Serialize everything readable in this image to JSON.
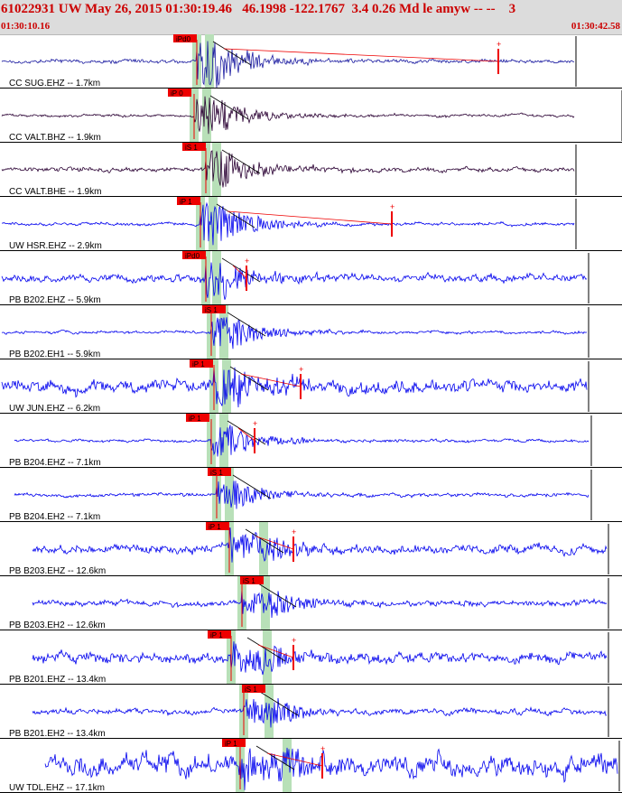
{
  "header": {
    "title": "61022931 UW May 26, 2015 01:30:19.46   46.1998 -122.1767  3.4 0.26 Md le amyw -- --    3",
    "start_time": "01:30:10.16",
    "end_time": "01:30:42.58"
  },
  "colors": {
    "trace_blue": "#0000ee",
    "trace_dark": "#2a0033",
    "pick_red": "#ee0000",
    "window_green": "#b8e0b8",
    "header_bg": "#dcdcdc"
  },
  "traces": [
    {
      "label": "CC SUG.EHZ -- 1.7km",
      "color": "dark_blue",
      "pick_tag": "iPd0"
    },
    {
      "label": "CC VALT.BHZ -- 1.9km",
      "color": "dark",
      "pick_tag": "iP 0"
    },
    {
      "label": "CC VALT.BHE -- 1.9km",
      "color": "dark",
      "pick_tag": "iS 1"
    },
    {
      "label": "UW HSR.EHZ -- 2.9km",
      "color": "blue",
      "pick_tag": "iP 1"
    },
    {
      "label": "PB B202.EHZ -- 5.9km",
      "color": "blue",
      "pick_tag": "iPd0"
    },
    {
      "label": "PB B202.EH1 -- 5.9km",
      "color": "blue",
      "pick_tag": "iS 1"
    },
    {
      "label": "UW JUN.EHZ -- 6.2km",
      "color": "blue",
      "pick_tag": "iP 1"
    },
    {
      "label": "PB B204.EHZ -- 7.1km",
      "color": "blue",
      "pick_tag": "iP 1"
    },
    {
      "label": "PB B204.EH2 -- 7.1km",
      "color": "blue",
      "pick_tag": "iS 1"
    },
    {
      "label": "PB B203.EHZ -- 12.6km",
      "color": "blue",
      "pick_tag": "iP 1"
    },
    {
      "label": "PB B203.EH2 -- 12.6km",
      "color": "blue",
      "pick_tag": "iS 1"
    },
    {
      "label": "PB B201.EHZ -- 13.4km",
      "color": "blue",
      "pick_tag": "iP 1"
    },
    {
      "label": "PB B201.EH2 -- 13.4km",
      "color": "blue",
      "pick_tag": "iS 1"
    },
    {
      "label": "UW TDL.EHZ -- 17.1km",
      "color": "blue",
      "pick_tag": "iP 1"
    }
  ]
}
